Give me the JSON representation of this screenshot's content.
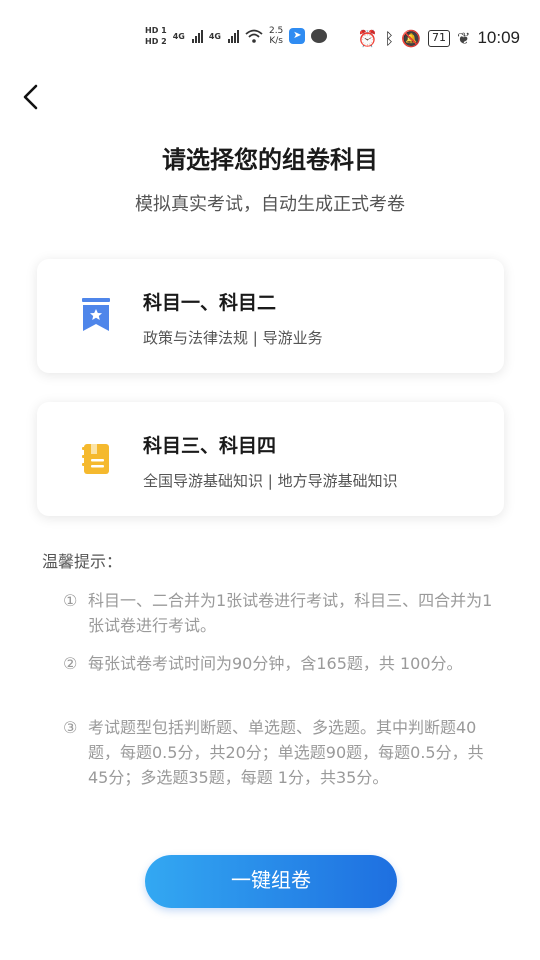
{
  "status_bar": {
    "hd1": "HD 1",
    "hd2": "HD 2",
    "net1": "4G",
    "net2": "4G",
    "speed_value": "2.5",
    "speed_unit": "K/s",
    "battery": "71",
    "time": "10:09"
  },
  "header": {
    "title": "请选择您的组卷科目",
    "subtitle": "模拟真实考试，自动生成正式考卷"
  },
  "subjects": [
    {
      "title": "科目一、科目二",
      "desc": "政策与法律法规 | 导游业务",
      "icon": "bookmark-star-icon",
      "color": "#4f86ea"
    },
    {
      "title": "科目三、科目四",
      "desc": "全国导游基础知识 | 地方导游基础知识",
      "icon": "notebook-icon",
      "color": "#f5b92e"
    }
  ],
  "tips": {
    "title": "温馨提示：",
    "items": [
      {
        "num": "①",
        "text": "科目一、二合并为1张试卷进行考试，科目三、四合并为1张试卷进行考试。"
      },
      {
        "num": "②",
        "text": "每张试卷考试时间为90分钟，含165题，共 100分。"
      },
      {
        "num": "③",
        "text": "考试题型包括判断题、单选题、多选题。其中判断题40题，每题0.5分，共20分；单选题90题，每题0.5分，共45分；多选题35题，每题 1分，共35分。"
      }
    ]
  },
  "action": {
    "label": "一键组卷"
  }
}
